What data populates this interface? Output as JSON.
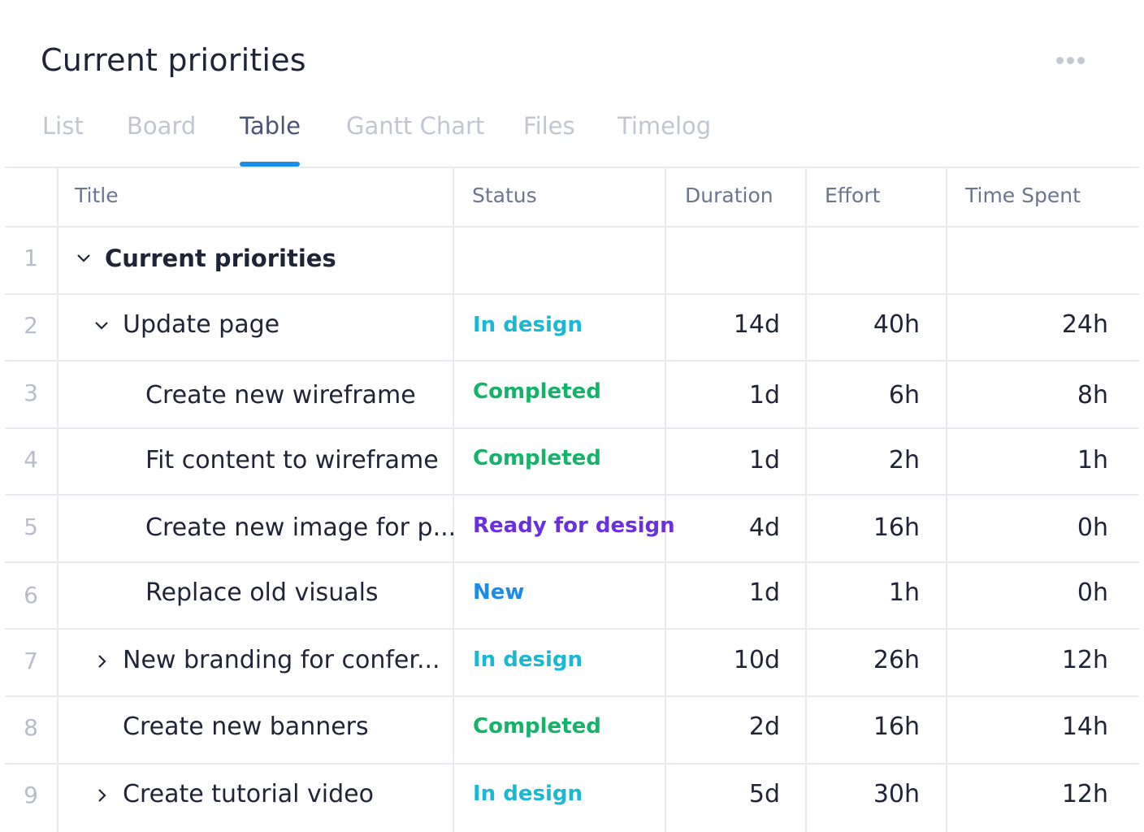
{
  "header": {
    "title": "Current priorities",
    "more_icon": "more-horizontal-icon"
  },
  "tabs": [
    {
      "label": "List",
      "active": false
    },
    {
      "label": "Board",
      "active": false
    },
    {
      "label": "Table",
      "active": true
    },
    {
      "label": "Gantt Chart",
      "active": false
    },
    {
      "label": "Files",
      "active": false
    },
    {
      "label": "Timelog",
      "active": false
    }
  ],
  "colors": {
    "accent": "#1d8be8",
    "in_design": "#19b8d4",
    "completed": "#13b46a",
    "ready_for_design": "#6a2fe0",
    "new": "#1d8be8"
  },
  "table": {
    "columns": [
      "Title",
      "Status",
      "Duration",
      "Effort",
      "Time Spent"
    ],
    "rows": [
      {
        "num": "1",
        "title": "Current priorities",
        "status": "",
        "duration": "",
        "effort": "",
        "time_spent": "",
        "chevron": "down"
      },
      {
        "num": "2",
        "title": "Update page",
        "status": "In design",
        "duration": "14d",
        "effort": "40h",
        "time_spent": "24h",
        "chevron": "down"
      },
      {
        "num": "3",
        "title": "Create new wireframe",
        "status": "Completed",
        "duration": "1d",
        "effort": "6h",
        "time_spent": "8h",
        "chevron": ""
      },
      {
        "num": "4",
        "title": "Fit content to wireframe",
        "status": "Completed",
        "duration": "1d",
        "effort": "2h",
        "time_spent": "1h",
        "chevron": ""
      },
      {
        "num": "5",
        "title": "Create new image for p...",
        "status": "Ready for design",
        "duration": "4d",
        "effort": "16h",
        "time_spent": "0h",
        "chevron": ""
      },
      {
        "num": "6",
        "title": "Replace old visuals",
        "status": "New",
        "duration": "1d",
        "effort": "1h",
        "time_spent": "0h",
        "chevron": ""
      },
      {
        "num": "7",
        "title": "New branding for confer...",
        "status": "In design",
        "duration": "10d",
        "effort": "26h",
        "time_spent": "12h",
        "chevron": "right"
      },
      {
        "num": "8",
        "title": "Create new banners",
        "status": "Completed",
        "duration": "2d",
        "effort": "16h",
        "time_spent": "14h",
        "chevron": ""
      },
      {
        "num": "9",
        "title": "Create tutorial video",
        "status": "In design",
        "duration": "5d",
        "effort": "30h",
        "time_spent": "12h",
        "chevron": "right"
      }
    ]
  }
}
